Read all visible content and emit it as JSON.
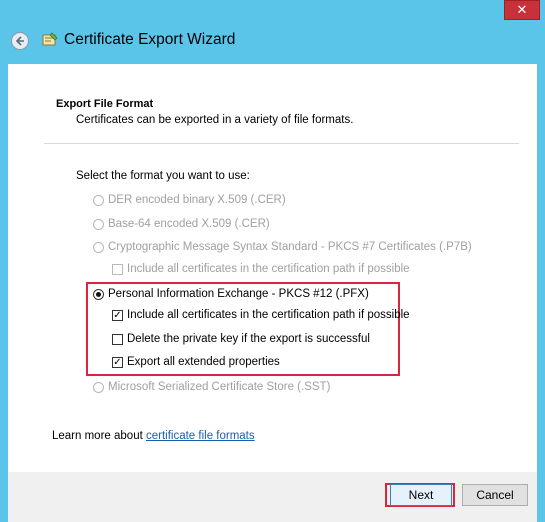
{
  "window": {
    "title": "Certificate Export Wizard",
    "close_label": "✕"
  },
  "section": {
    "title": "Export File Format",
    "subtitle": "Certificates can be exported in a variety of file formats."
  },
  "prompt": "Select the format you want to use:",
  "options": {
    "der": {
      "label": "DER encoded binary X.509 (.CER)",
      "selected": false,
      "enabled": false
    },
    "base64": {
      "label": "Base-64 encoded X.509 (.CER)",
      "selected": false,
      "enabled": false
    },
    "pkcs7": {
      "label": "Cryptographic Message Syntax Standard - PKCS #7 Certificates (.P7B)",
      "selected": false,
      "enabled": false
    },
    "pkcs7_include": {
      "label": "Include all certificates in the certification path if possible",
      "checked": false,
      "enabled": false
    },
    "pfx": {
      "label": "Personal Information Exchange - PKCS #12 (.PFX)",
      "selected": true,
      "enabled": true
    },
    "pfx_include": {
      "label": "Include all certificates in the certification path if possible",
      "checked": true,
      "enabled": true
    },
    "pfx_delete_key": {
      "label": "Delete the private key if the export is successful",
      "checked": false,
      "enabled": true
    },
    "pfx_export_ext": {
      "label": "Export all extended properties",
      "checked": true,
      "enabled": true
    },
    "sst": {
      "label": "Microsoft Serialized Certificate Store (.SST)",
      "selected": false,
      "enabled": false
    }
  },
  "learn_more": {
    "prefix": "Learn more about ",
    "link": "certificate file formats"
  },
  "buttons": {
    "next": "Next",
    "cancel": "Cancel"
  },
  "colors": {
    "titlebar": "#5bc4e9",
    "highlight": "#d7263d",
    "link": "#1a5eb0"
  }
}
